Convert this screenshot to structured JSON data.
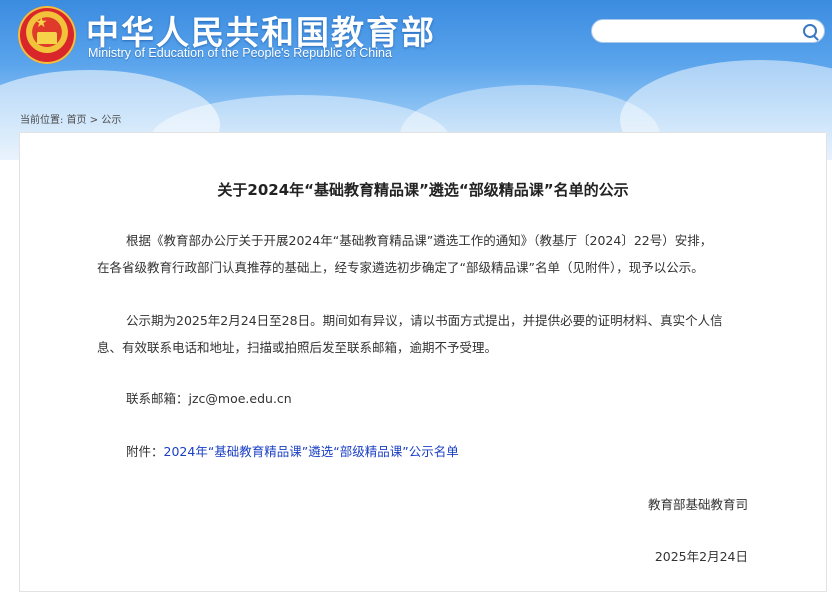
{
  "header": {
    "title_cn": "中华人民共和国教育部",
    "title_en": "Ministry of Education of the People's Republic of China",
    "search_placeholder": ""
  },
  "breadcrumb": {
    "prefix": "当前位置:",
    "home": "首页",
    "separator": ">",
    "current": "公示"
  },
  "article": {
    "title": "关于2024年“基础教育精品课”遴选“部级精品课”名单的公示",
    "para1_line1": "根据《教育部办公厅关于开展2024年“基础教育精品课”遴选工作的通知》（教基厅〔2024〕22号）安排，",
    "para1_line2": "在各省级教育行政部门认真推荐的基础上，经专家遴选初步确定了“部级精品课”名单（见附件），现予以公示。",
    "para2_line1": "公示期为2025年2月24日至28日。期间如有异议，请以书面方式提出，并提供必要的证明材料、真实个人信",
    "para2_line2": "息、有效联系电话和地址，扫描或拍照后发至联系邮箱，逾期不予受理。",
    "contact_label": "联系邮箱：",
    "contact_email": "jzc@moe.edu.cn",
    "attachment_label": "附件：",
    "attachment_link": "2024年“基础教育精品课”遴选“部级精品课”公示名单",
    "signature": "教育部基础教育司",
    "date": "2025年2月24日"
  },
  "colors": {
    "header_blue": "#3b8be0",
    "link_blue": "#1a3fc4",
    "text": "#333333"
  }
}
